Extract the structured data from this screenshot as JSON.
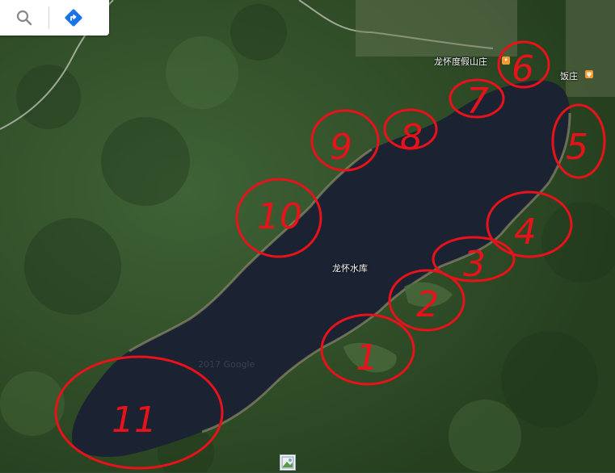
{
  "toolbar": {
    "search_icon": "search-icon",
    "directions_icon": "directions-icon"
  },
  "labels": {
    "resort": "龙怀度假山庄",
    "restaurant": "饭庄",
    "reservoir": "龙怀水库",
    "watermark": "2017 Google"
  },
  "markers": [
    "1",
    "2",
    "3",
    "4",
    "5",
    "6",
    "7",
    "8",
    "9",
    "10",
    "11"
  ],
  "colors": {
    "water": "#1b2333",
    "forest": "#2f4a2c",
    "marker": "#e8121a",
    "directions": "#1a73e8"
  }
}
